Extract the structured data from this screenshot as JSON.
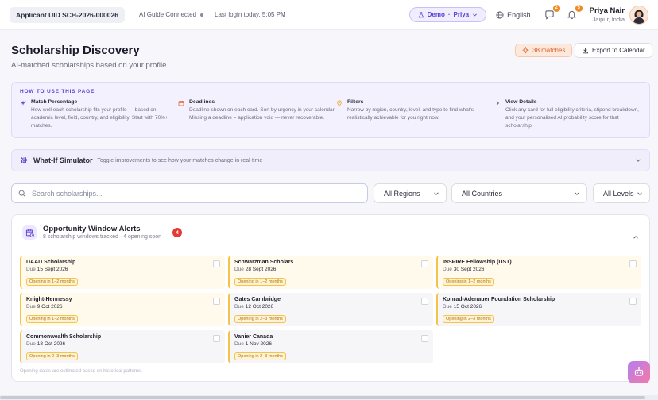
{
  "topbar": {
    "uid": "Applicant UID SCH-2026-000026",
    "ai_status": "AI Guide Connected",
    "last_login": "Last login today, 5:05 PM",
    "demo_label": "Demo",
    "demo_user": "Priya",
    "language": "English",
    "messages_count": "2",
    "notifications_count": "5",
    "user_name": "Priya Nair",
    "user_location": "Jaipur, India"
  },
  "header": {
    "title": "Scholarship Discovery",
    "subtitle": "AI-matched scholarships based on your profile",
    "matches": "38 matches",
    "export_label": "Export to Calendar"
  },
  "howto": {
    "title": "HOW TO USE THIS PAGE",
    "items": [
      {
        "icon": "sparkle-icon",
        "heading": "Match Percentage",
        "text": "How well each scholarship fits your profile — based on academic level, field, country, and eligibility. Start with 70%+ matches."
      },
      {
        "icon": "calendar-icon",
        "heading": "Deadlines",
        "text": "Deadline shown on each card. Sort by urgency in your calendar. Missing a deadline = application void — never recoverable."
      },
      {
        "icon": "pin-icon",
        "heading": "Filters",
        "text": "Narrow by region, country, level, and type to find what's realistically achievable for you right now."
      },
      {
        "icon": "chevron-right-icon",
        "heading": "View Details",
        "text": "Click any card for full eligibility criteria, stipend breakdown, and your personalised AI probability score for that scholarship."
      }
    ]
  },
  "whatif": {
    "title": "What-If Simulator",
    "desc": "Toggle improvements to see how your matches change in real-time"
  },
  "filters": {
    "search_placeholder": "Search scholarships...",
    "region": "All Regions",
    "country": "All Countries",
    "level": "All Levels"
  },
  "alerts": {
    "title": "Opportunity Window Alerts",
    "subtitle": "8 scholarship windows tracked · 4 opening soon",
    "count": "4",
    "note": "Opening dates are estimated based on historical patterns.",
    "due_prefix": "Due",
    "cards": [
      {
        "name": "DAAD Scholarship",
        "due": "15 Sept 2026",
        "window": "Opening in 1–2 months"
      },
      {
        "name": "Schwarzman Scholars",
        "due": "28 Sept 2026",
        "window": "Opening in 1–2 months"
      },
      {
        "name": "INSPIRE Fellowship (DST)",
        "due": "30 Sept 2026",
        "window": "Opening in 1–2 months"
      },
      {
        "name": "Knight-Hennessy",
        "due": "9 Oct 2026",
        "window": "Opening in 1–2 months"
      },
      {
        "name": "Gates Cambridge",
        "due": "12 Oct 2026",
        "window": "Opening in 2–3 months"
      },
      {
        "name": "Konrad-Adenauer Foundation Scholarship",
        "due": "15 Oct 2026",
        "window": "Opening in 2–3 months"
      },
      {
        "name": "Commonwealth Scholarship",
        "due": "18 Oct 2026",
        "window": "Opening in 2–3 months"
      },
      {
        "name": "Vanier Canada",
        "due": "1 Nov 2026",
        "window": "Opening in 2–3 months"
      }
    ]
  },
  "colors": {
    "accent": "#5a3fd1",
    "warning": "#f3c34a",
    "alert_badge": "#e53935"
  }
}
